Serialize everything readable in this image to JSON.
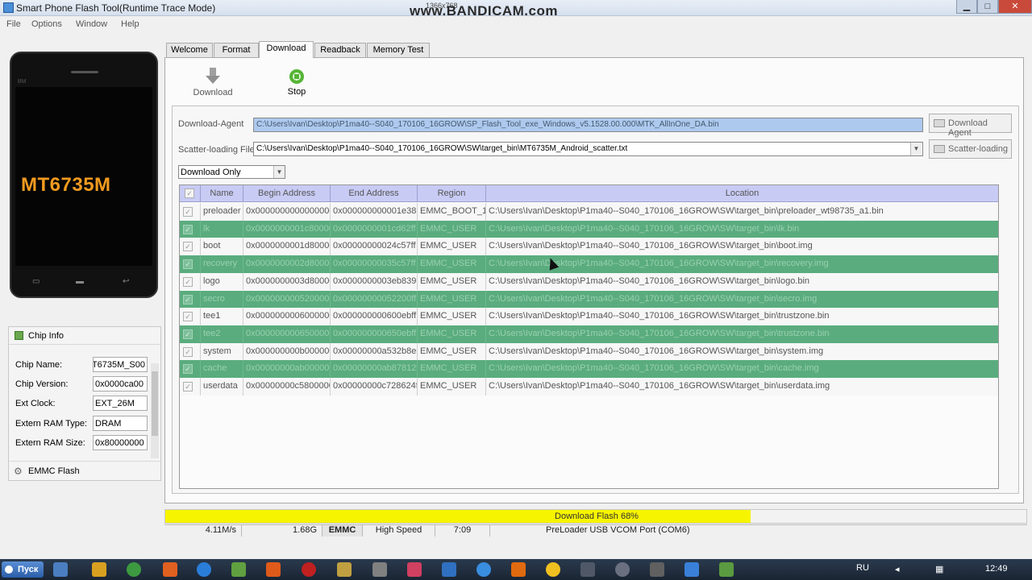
{
  "window": {
    "title": "Smart Phone Flash Tool(Runtime Trace Mode)",
    "watermark": "www.BANDICAM.com",
    "resolution": "1366x768"
  },
  "menu": [
    "File",
    "Options",
    "Window",
    "Help"
  ],
  "phone": {
    "chip_label": "MT6735M",
    "brand": "BM"
  },
  "chip_info": {
    "title": "Chip Info",
    "rows": [
      {
        "label": "Chip Name:",
        "value": "MT6735M_S00"
      },
      {
        "label": "Chip Version:",
        "value": "0x0000ca00"
      },
      {
        "label": "Ext Clock:",
        "value": "EXT_26M"
      },
      {
        "label": "Extern RAM Type:",
        "value": "DRAM"
      },
      {
        "label": "Extern RAM Size:",
        "value": "0x80000000"
      }
    ],
    "footer": "EMMC Flash"
  },
  "tabs": [
    {
      "label": "Welcome",
      "active": false
    },
    {
      "label": "Format",
      "active": false
    },
    {
      "label": "Download",
      "active": true
    },
    {
      "label": "Readback",
      "active": false
    },
    {
      "label": "Memory Test",
      "active": false
    }
  ],
  "toolbar": {
    "download_label": "Download",
    "stop_label": "Stop"
  },
  "download_agent": {
    "label": "Download-Agent",
    "value": "C:\\Users\\Ivan\\Desktop\\P1ma40--S040_170106_16GROW\\SP_Flash_Tool_exe_Windows_v5.1528.00.000\\MTK_AllInOne_DA.bin",
    "button": "Download Agent"
  },
  "scatter": {
    "label": "Scatter-loading File",
    "value": "C:\\Users\\Ivan\\Desktop\\P1ma40--S040_170106_16GROW\\SW\\target_bin\\MT6735M_Android_scatter.txt",
    "button": "Scatter-loading"
  },
  "mode": {
    "selected": "Download Only"
  },
  "table": {
    "headers": [
      "Name",
      "Begin Address",
      "End Address",
      "Region",
      "Location"
    ],
    "rows": [
      {
        "name": "preloader",
        "begin": "0x0000000000000000",
        "end": "0x000000000001e38b",
        "region": "EMMC_BOOT_1",
        "location": "C:\\Users\\Ivan\\Desktop\\P1ma40--S040_170106_16GROW\\SW\\target_bin\\preloader_wt98735_a1.bin",
        "highlight": false
      },
      {
        "name": "lk",
        "begin": "0x0000000001c80000",
        "end": "0x0000000001cd62ff",
        "region": "EMMC_USER",
        "location": "C:\\Users\\Ivan\\Desktop\\P1ma40--S040_170106_16GROW\\SW\\target_bin\\lk.bin",
        "highlight": true
      },
      {
        "name": "boot",
        "begin": "0x0000000001d80000",
        "end": "0x00000000024c57ff",
        "region": "EMMC_USER",
        "location": "C:\\Users\\Ivan\\Desktop\\P1ma40--S040_170106_16GROW\\SW\\target_bin\\boot.img",
        "highlight": false
      },
      {
        "name": "recovery",
        "begin": "0x0000000002d80000",
        "end": "0x00000000035c57ff",
        "region": "EMMC_USER",
        "location": "C:\\Users\\Ivan\\Desktop\\P1ma40--S040_170106_16GROW\\SW\\target_bin\\recovery.img",
        "highlight": true
      },
      {
        "name": "logo",
        "begin": "0x0000000003d80000",
        "end": "0x0000000003eb8397",
        "region": "EMMC_USER",
        "location": "C:\\Users\\Ivan\\Desktop\\P1ma40--S040_170106_16GROW\\SW\\target_bin\\logo.bin",
        "highlight": false
      },
      {
        "name": "secro",
        "begin": "0x0000000005200000",
        "end": "0x00000000052200ff",
        "region": "EMMC_USER",
        "location": "C:\\Users\\Ivan\\Desktop\\P1ma40--S040_170106_16GROW\\SW\\target_bin\\secro.img",
        "highlight": true
      },
      {
        "name": "tee1",
        "begin": "0x0000000006000000",
        "end": "0x000000000600ebff",
        "region": "EMMC_USER",
        "location": "C:\\Users\\Ivan\\Desktop\\P1ma40--S040_170106_16GROW\\SW\\target_bin\\trustzone.bin",
        "highlight": false
      },
      {
        "name": "tee2",
        "begin": "0x0000000006500000",
        "end": "0x000000000650ebff",
        "region": "EMMC_USER",
        "location": "C:\\Users\\Ivan\\Desktop\\P1ma40--S040_170106_16GROW\\SW\\target_bin\\trustzone.bin",
        "highlight": true
      },
      {
        "name": "system",
        "begin": "0x000000000b000000",
        "end": "0x00000000a532b8e3",
        "region": "EMMC_USER",
        "location": "C:\\Users\\Ivan\\Desktop\\P1ma40--S040_170106_16GROW\\SW\\target_bin\\system.img",
        "highlight": false
      },
      {
        "name": "cache",
        "begin": "0x00000000ab000000",
        "end": "0x00000000ab87812f",
        "region": "EMMC_USER",
        "location": "C:\\Users\\Ivan\\Desktop\\P1ma40--S040_170106_16GROW\\SW\\target_bin\\cache.img",
        "highlight": true
      },
      {
        "name": "userdata",
        "begin": "0x00000000c5800000",
        "end": "0x00000000c728624f",
        "region": "EMMC_USER",
        "location": "C:\\Users\\Ivan\\Desktop\\P1ma40--S040_170106_16GROW\\SW\\target_bin\\userdata.img",
        "highlight": false
      }
    ]
  },
  "progress": {
    "text": "Download Flash 68%",
    "percent": 68,
    "color": "#f7f400"
  },
  "status": {
    "speed": "4.11M/s",
    "size": "1.68G",
    "storage": "EMMC",
    "usb": "High Speed",
    "time": "7:09",
    "port": "PreLoader USB VCOM Port (COM6)"
  },
  "taskbar": {
    "start_label": "Пуск",
    "lang": "RU",
    "clock": "12:49"
  },
  "colors": {
    "row_highlight": "#5aac7e",
    "header": "#c8cbf4",
    "chip_text": "#f29b1f"
  }
}
